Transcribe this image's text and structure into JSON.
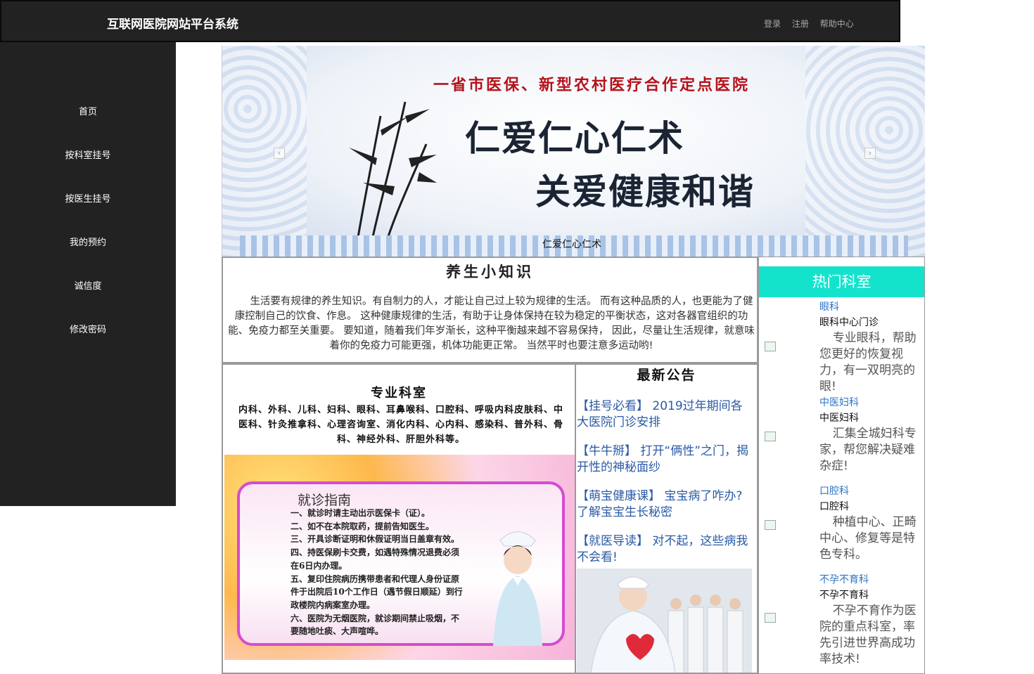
{
  "header": {
    "brand": "互联网医院网站平台系统",
    "links": [
      "登录",
      "注册",
      "帮助中心"
    ]
  },
  "sidebar": {
    "items": [
      {
        "label": "首页"
      },
      {
        "label": "按科室挂号"
      },
      {
        "label": "按医生挂号"
      },
      {
        "label": "我的预约"
      },
      {
        "label": "诚信度"
      },
      {
        "label": "修改密码"
      }
    ]
  },
  "banner": {
    "tagline": "一省市医保、新型农村医疗合作定点医院",
    "slogan_line1": "仁爱仁心仁术",
    "slogan_line2": "关爱健康和谐",
    "caption": "仁爱仁心仁术"
  },
  "tips": {
    "title": "养生小知识",
    "text": "生活要有规律的养生知识。有自制力的人，才能让自己过上较为规律的生活。 而有这种品质的人，也更能为了健康控制自己的饮食、作息。 这种健康规律的生活，有助于让身体保持在较为稳定的平衡状态，这对各器官组织的功能、免疫力都至关重要。 要知道，随着我们年岁渐长，这种平衡越来越不容易保持， 因此，尽量让生活规律，就意味着你的免疫力可能更强，机体功能更正常。 当然平时也要注意多运动哟!"
  },
  "departments": {
    "title": "专业科室",
    "list": "内科、外科、儿科、妇科、眼科、耳鼻喉科、口腔科、呼吸内科皮肤科、中医科、针灸推拿科、心理咨询室、消化内科、心内科、感染科、普外科、骨科、神经外科、肝胆外科等。",
    "guide": {
      "title": "就诊指南",
      "items": [
        "一、就诊时请主动出示医保卡（证）。",
        "二、如不在本院取药，提前告知医生。",
        "三、开具诊断证明和休假证明当日盖章有效。",
        "四、持医保刷卡交费，如遇特殊情况退费必须在6日内办理。",
        "五、复印住院病历携带患者和代理人身份证原件于出院后10个工作日（遇节假日顺延）到行政楼院内病案室办理。",
        "六、医院为无烟医院，就诊期间禁止吸烟，不要随地吐痰、大声喧哗。"
      ]
    }
  },
  "notices": {
    "title": "最新公告",
    "items": [
      "【挂号必看】 2019过年期间各大医院门诊安排",
      "【牛牛掰】 打开“俩性”之门，揭开性的神秘面纱",
      "【萌宝健康课】 宝宝病了咋办? 了解宝宝生长秘密",
      "【就医导读】 对不起，这些病我不会看!"
    ]
  },
  "hot": {
    "title": "热门科室",
    "items": [
      {
        "link": "眼科",
        "name": "眼科中心门诊",
        "desc": "专业眼科，帮助您更好的恢复视力，有一双明亮的眼!"
      },
      {
        "link": "中医妇科",
        "name": "中医妇科",
        "desc": "汇集全城妇科专家，帮您解决疑难杂症!"
      },
      {
        "link": "口腔科",
        "name": "口腔科",
        "desc": "种植中心、正畸中心、修复等是特色专科。"
      },
      {
        "link": "不孕不育科",
        "name": "不孕不育科",
        "desc": "不孕不育作为医院的重点科室，率先引进世界高成功率技术!"
      }
    ]
  },
  "colors": {
    "nav_bg": "#222222",
    "hot_header": "#14e3cc",
    "notice_link": "#2a5aa6",
    "hot_link": "#2c73c5"
  }
}
